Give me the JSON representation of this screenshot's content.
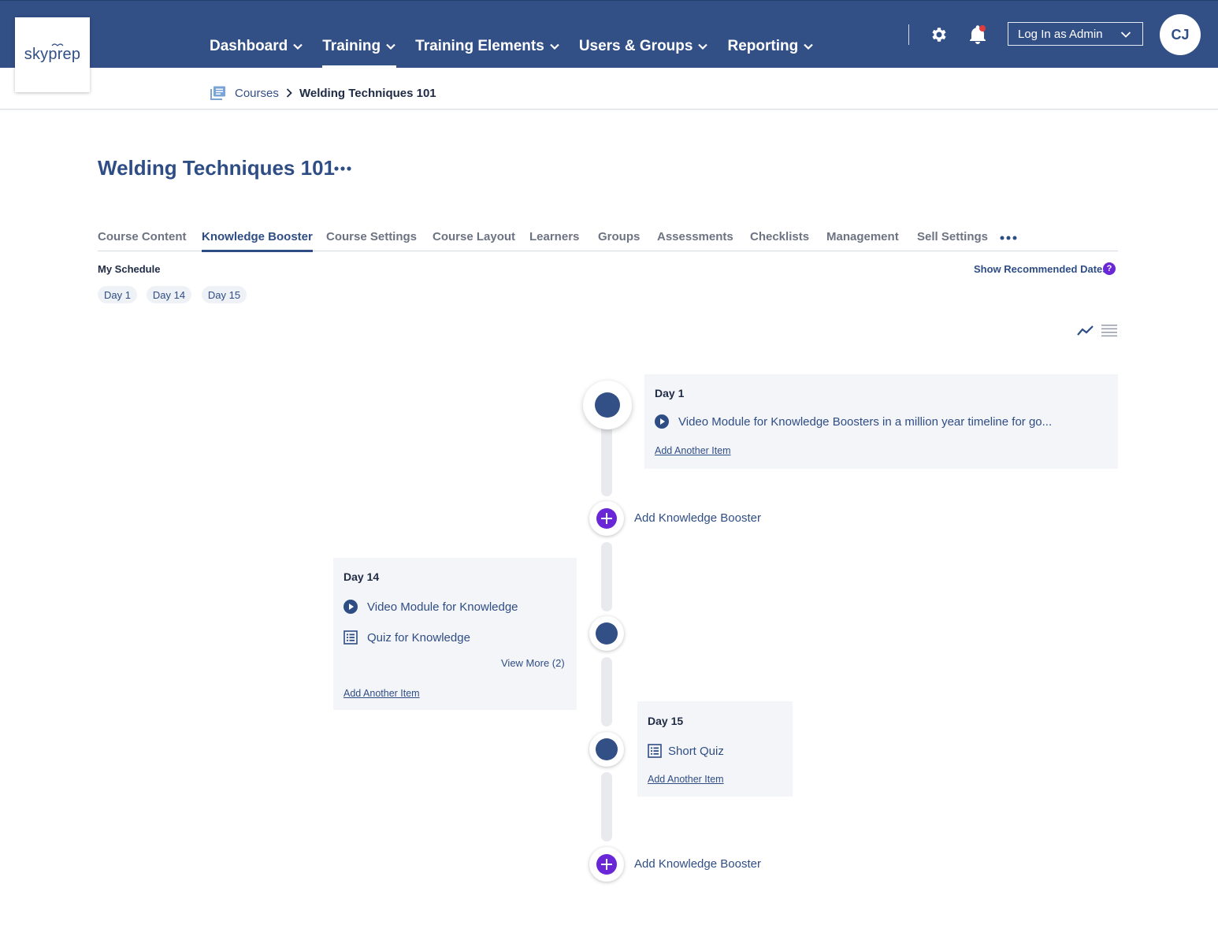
{
  "brand": {
    "logo_text_a": "sky",
    "logo_text_b": "prep"
  },
  "nav": {
    "items": [
      {
        "label": "Dashboard"
      },
      {
        "label": "Training"
      },
      {
        "label": "Training Elements"
      },
      {
        "label": "Users & Groups"
      },
      {
        "label": "Reporting"
      }
    ],
    "admin_select": "Log In as Admin",
    "avatar_initials": "CJ"
  },
  "breadcrumb": {
    "parent": "Courses",
    "current": "Welding Techniques 101"
  },
  "page": {
    "title": "Welding Techniques 101"
  },
  "tabs": [
    {
      "label": "Course Content"
    },
    {
      "label": "Knowledge Booster"
    },
    {
      "label": "Course Settings"
    },
    {
      "label": "Course Layout"
    },
    {
      "label": "Learners"
    },
    {
      "label": "Groups"
    },
    {
      "label": "Assessments"
    },
    {
      "label": "Checklists"
    },
    {
      "label": "Management"
    },
    {
      "label": "Sell Settings"
    }
  ],
  "schedule": {
    "label": "My Schedule",
    "show_recommended": "Show Recommended Dates",
    "help_glyph": "?",
    "chips": [
      "Day 1",
      "Day 14",
      "Day 15"
    ]
  },
  "timeline": {
    "add_booster_label": "Add Knowledge Booster",
    "add_item_label": "Add Another Item",
    "cards": [
      {
        "day": "Day 1",
        "items": [
          {
            "type": "video",
            "label": "Video Module for Knowledge Boosters in a million year timeline for go..."
          }
        ]
      },
      {
        "day": "Day 14",
        "items": [
          {
            "type": "video",
            "label": "Video Module for Knowledge"
          },
          {
            "type": "quiz",
            "label": "Quiz for Knowledge"
          }
        ],
        "view_more": "View More (2)"
      },
      {
        "day": "Day 15",
        "items": [
          {
            "type": "quiz",
            "label": "Short Quiz"
          }
        ]
      }
    ]
  },
  "colors": {
    "header": "#324f86",
    "accent": "#6a27d8",
    "text_link": "#2f4d85"
  },
  "icons": [
    "chevron-down-icon",
    "gear-icon",
    "bell-icon",
    "courses-icon",
    "chevron-right-icon",
    "more-horizontal-icon",
    "help-icon",
    "trend-view-icon",
    "list-view-icon",
    "play-icon",
    "quiz-icon",
    "plus-icon"
  ]
}
